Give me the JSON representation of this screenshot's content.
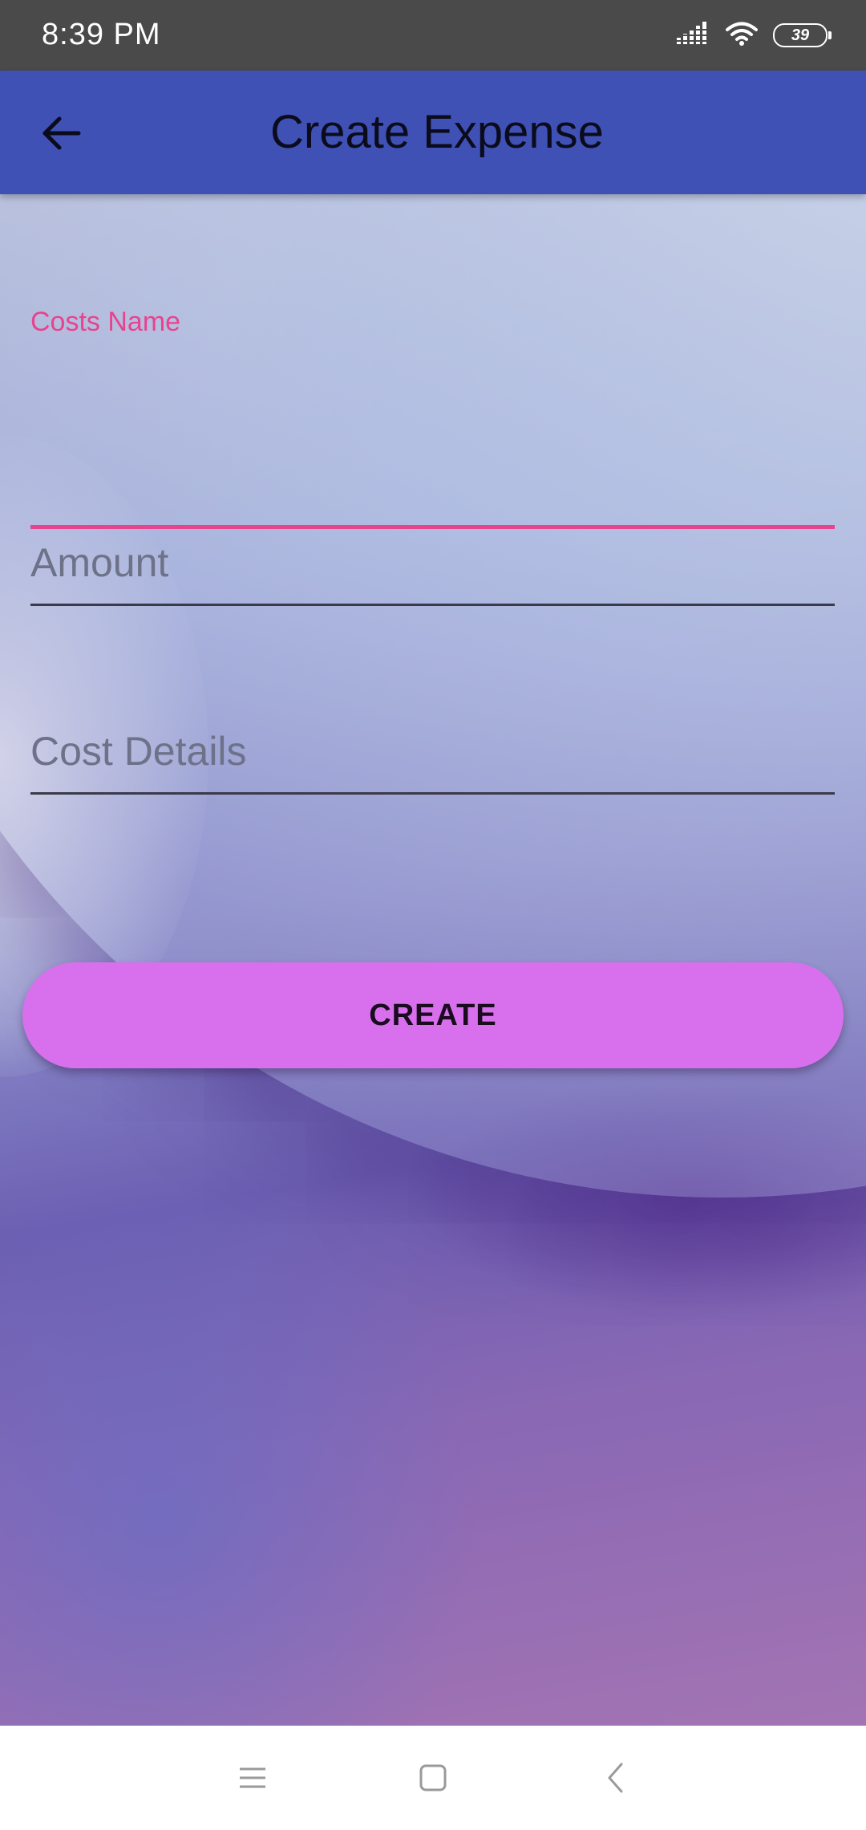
{
  "status_bar": {
    "time": "8:39 PM",
    "battery_level": "39",
    "icons": [
      "signal-icon",
      "wifi-icon",
      "battery-icon"
    ]
  },
  "app_bar": {
    "title": "Create Expense",
    "back_icon": "arrow-left-icon",
    "background_color": "#3f51b5"
  },
  "form": {
    "costs_name": {
      "label": "Costs Name",
      "value": "",
      "focused": true,
      "accent_color": "#e8438e"
    },
    "amount": {
      "placeholder": "Amount",
      "value": ""
    },
    "cost_details": {
      "placeholder": "Cost Details",
      "value": ""
    },
    "create_button": {
      "label": "CREATE",
      "color": "#d870ee"
    }
  },
  "nav_bar": {
    "icons": [
      "menu-icon",
      "home-icon",
      "back-icon"
    ]
  }
}
